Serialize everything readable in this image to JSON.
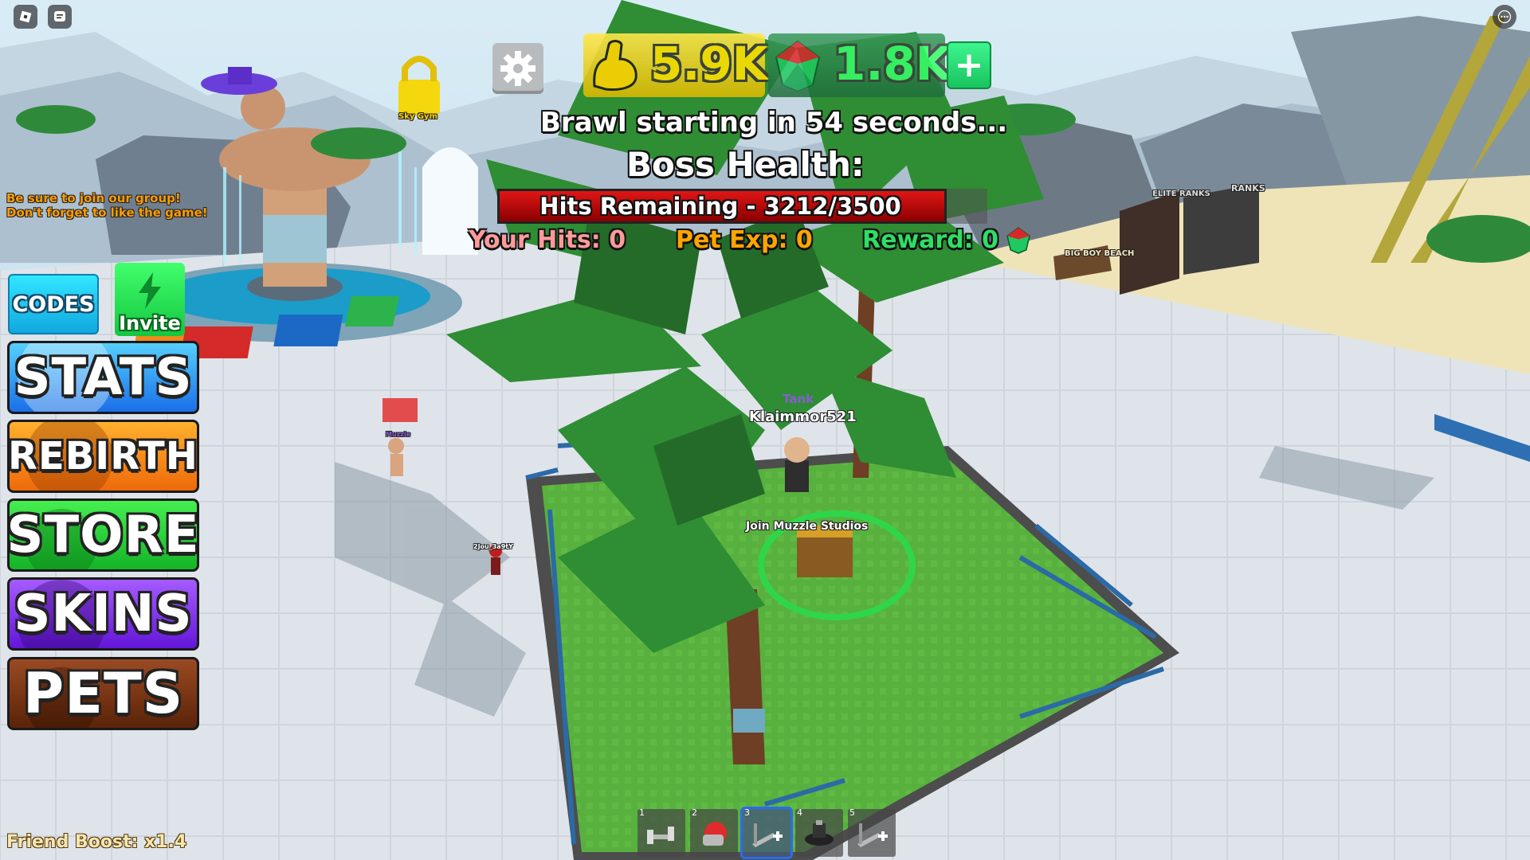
{
  "hud": {
    "strength_value": "5.9K",
    "gems_value": "1.8K",
    "plus_label": "+",
    "brawl_text": "Brawl starting in 54 seconds...",
    "boss_health_title": "Boss Health:",
    "hits_remaining_label": "Hits Remaining - 3212/3500",
    "boss_health_fraction": 0.9177,
    "your_hits_label": "Your Hits: 0",
    "pet_exp_label": "Pet Exp: 0",
    "reward_label": "Reward: 0"
  },
  "side_notes": {
    "line1": "Be sure to join our group!",
    "line2": "Don't forget to like the game!"
  },
  "menu": {
    "codes": "CODES",
    "invite": "Invite",
    "stats": "STATS",
    "rebirth": "REBIRTH",
    "store": "STORE",
    "skins": "SKINS",
    "pets": "PETS"
  },
  "world_labels": {
    "player_rank": "Tank",
    "player_name": "Klaimmor521",
    "chest_label": "Join Muzzle Studios",
    "lock_label_1": "Sky Gym",
    "big_boy_beach": "BIG BOY BEACH",
    "ranks_sign": "RANKS",
    "elite_ranks_sign": "ELITE RANKS",
    "npc_name_1": "Muzzle",
    "npc_name_2": "2Jou_3a9tY"
  },
  "friend_boost": "Friend Boost: x1.4",
  "hotbar": [
    {
      "num": "1",
      "icon": "dumbbell-icon"
    },
    {
      "num": "2",
      "icon": "punch-glove-icon"
    },
    {
      "num": "3",
      "icon": "treadmill-plus-icon"
    },
    {
      "num": "4",
      "icon": "weight-stack-icon"
    },
    {
      "num": "5",
      "icon": "treadmill-plus-icon"
    }
  ],
  "colors": {
    "strength_text": "#ffe100",
    "gems_text": "#37ff6a",
    "pet_exp_text": "#ffa500",
    "reward_text": "#2ddf63",
    "your_hits_text": "#ff9a9a",
    "side_note_text": "#ff9d00",
    "hotbar_selected": "#2a6cf0"
  }
}
